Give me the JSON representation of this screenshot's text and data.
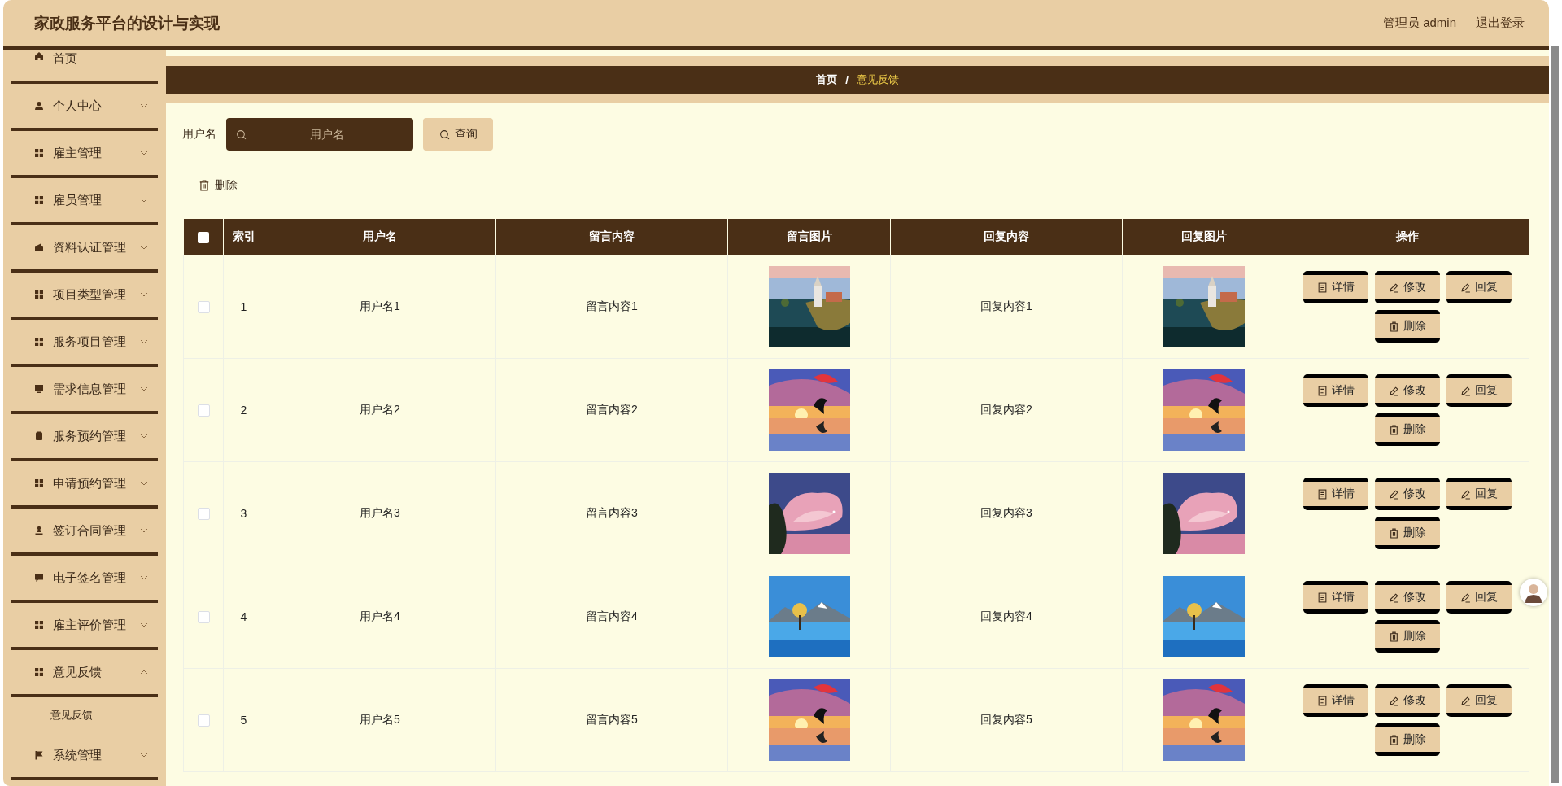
{
  "header": {
    "title": "家政服务平台的设计与实现",
    "user": "管理员 admin",
    "logout": "退出登录"
  },
  "sidebar": {
    "items": [
      {
        "label": "首页"
      },
      {
        "label": "个人中心",
        "expanded": false
      },
      {
        "label": "雇主管理",
        "expanded": false
      },
      {
        "label": "雇员管理",
        "expanded": false
      },
      {
        "label": "资料认证管理",
        "expanded": false
      },
      {
        "label": "项目类型管理",
        "expanded": false
      },
      {
        "label": "服务项目管理",
        "expanded": false
      },
      {
        "label": "需求信息管理",
        "expanded": false
      },
      {
        "label": "服务预约管理",
        "expanded": false
      },
      {
        "label": "申请预约管理",
        "expanded": false
      },
      {
        "label": "签订合同管理",
        "expanded": false
      },
      {
        "label": "电子签名管理",
        "expanded": false
      },
      {
        "label": "雇主评价管理",
        "expanded": false
      },
      {
        "label": "意见反馈",
        "expanded": true,
        "children": [
          {
            "label": "意见反馈"
          }
        ]
      },
      {
        "label": "系统管理",
        "expanded": false
      }
    ]
  },
  "breadcrumb": {
    "items": [
      "首页",
      "意见反馈"
    ],
    "separator": "/"
  },
  "search": {
    "label": "用户名",
    "placeholder": "用户名",
    "button": "查询"
  },
  "toolbar": {
    "delete": "删除"
  },
  "table": {
    "select_all": {
      "checked": false
    },
    "columns": [
      "索引",
      "用户名",
      "留言内容",
      "留言图片",
      "回复内容",
      "回复图片",
      "操作"
    ],
    "rows": [
      {
        "selected": false,
        "index": "1",
        "username": "用户名1",
        "message": "留言内容1",
        "reply": "回复内容1",
        "actions": [
          "详情",
          "修改",
          "回复",
          "删除"
        ]
      },
      {
        "selected": false,
        "index": "2",
        "username": "用户名2",
        "message": "留言内容2",
        "reply": "回复内容2",
        "actions": [
          "详情",
          "修改",
          "回复",
          "删除"
        ]
      },
      {
        "selected": false,
        "index": "3",
        "username": "用户名3",
        "message": "留言内容3",
        "reply": "回复内容3",
        "actions": [
          "详情",
          "修改",
          "回复",
          "删除"
        ]
      },
      {
        "selected": false,
        "index": "4",
        "username": "用户名4",
        "message": "留言内容4",
        "reply": "回复内容4",
        "actions": [
          "详情",
          "修改",
          "回复",
          "删除"
        ]
      },
      {
        "selected": false,
        "index": "5",
        "username": "用户名5",
        "message": "留言内容5",
        "reply": "回复内容5",
        "actions": [
          "详情",
          "修改",
          "回复",
          "删除"
        ]
      }
    ]
  }
}
